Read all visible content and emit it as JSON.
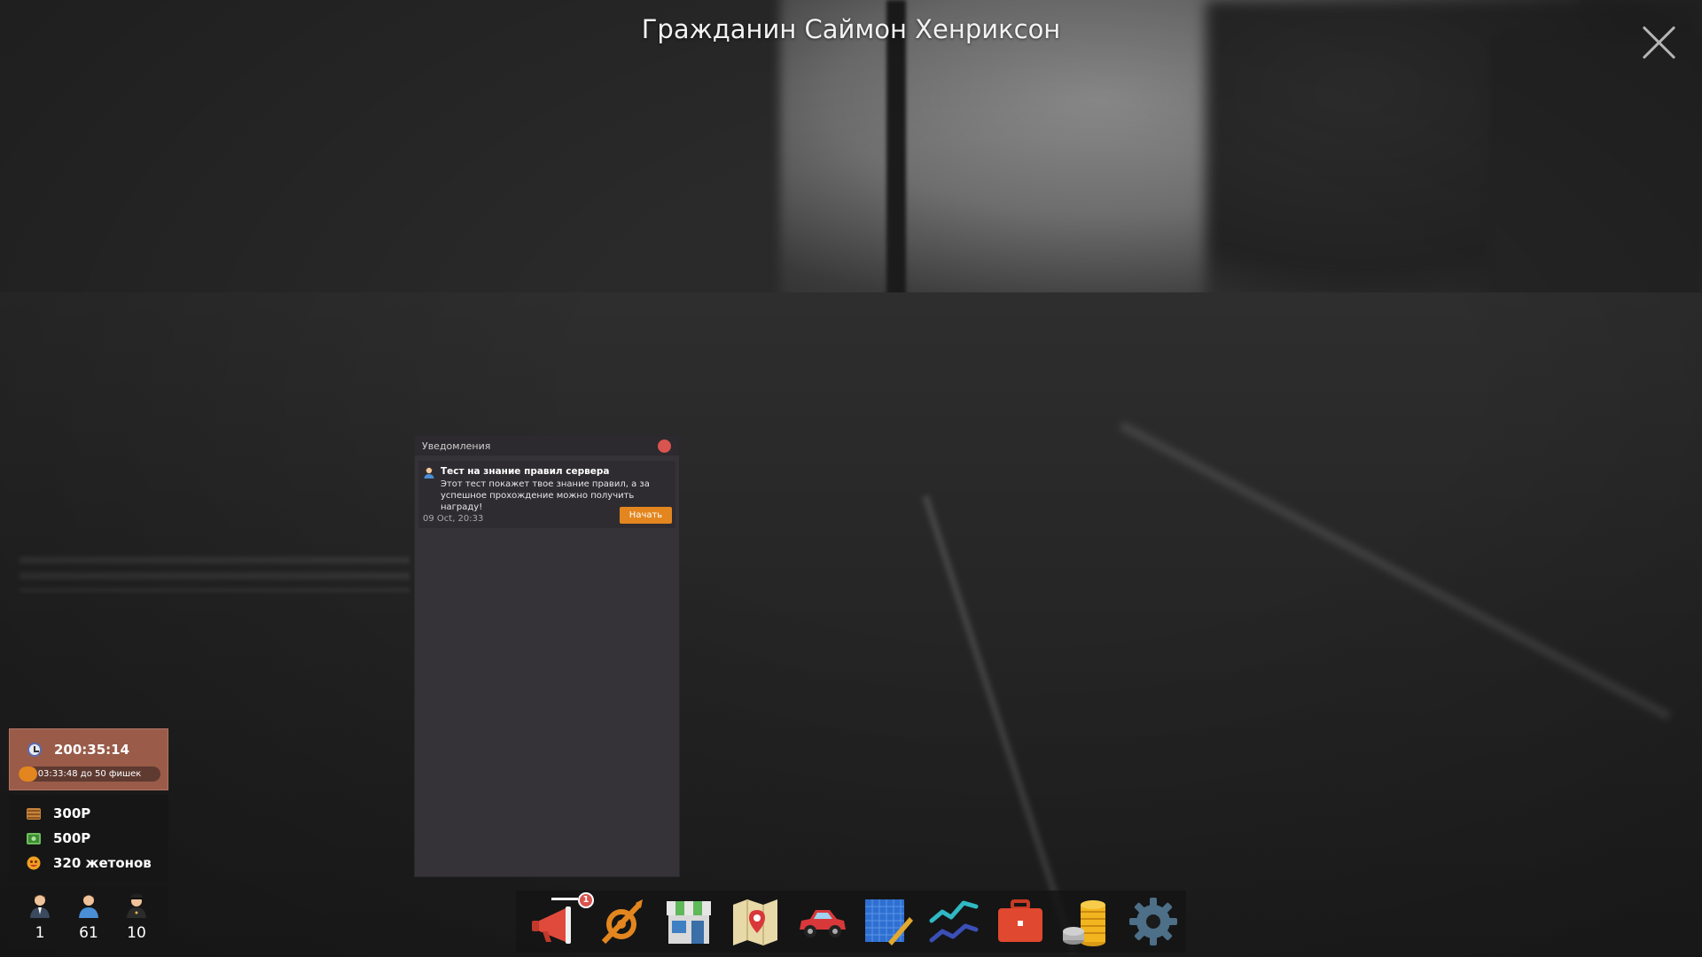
{
  "header": {
    "player_name": "Гражданин Саймон Хенриксон"
  },
  "notifications": {
    "title": "Уведомления",
    "items": [
      {
        "icon": "person-icon",
        "title": "Тест на знание правил сервера",
        "body": "Этот тест покажет твое знание правил, а за успешное прохождение можно получить награду!",
        "date": "09 Oct, 20:33",
        "action_label": "Начать"
      }
    ]
  },
  "hud": {
    "playtime": "200:35:14",
    "chips_progress_text": "03:33:48 до 50 фишек",
    "chips_progress_fraction": 0.13,
    "money": [
      {
        "icon": "cash-stack-icon",
        "value": "300Р"
      },
      {
        "icon": "banknote-icon",
        "value": "500Р"
      },
      {
        "icon": "token-face-icon",
        "value": "320 жетонов"
      }
    ],
    "people": [
      {
        "icon": "businessman-icon",
        "value": "1"
      },
      {
        "icon": "citizen-icon",
        "value": "61"
      },
      {
        "icon": "police-officer-icon",
        "value": "10"
      }
    ]
  },
  "toolbar": {
    "items": [
      {
        "icon": "megaphone-icon",
        "badge": "1"
      },
      {
        "icon": "gang-emblem-icon"
      },
      {
        "icon": "shop-icon"
      },
      {
        "icon": "map-icon"
      },
      {
        "icon": "car-icon"
      },
      {
        "icon": "blueprint-ruler-icon"
      },
      {
        "icon": "stats-graph-icon"
      },
      {
        "icon": "briefcase-icon"
      },
      {
        "icon": "coins-icon"
      },
      {
        "icon": "settings-gear-icon"
      }
    ]
  },
  "colors": {
    "accent_orange": "#e3861f",
    "close_red": "#d9534f",
    "time_box": "#9a5b49",
    "panel_bg": "#353238"
  }
}
